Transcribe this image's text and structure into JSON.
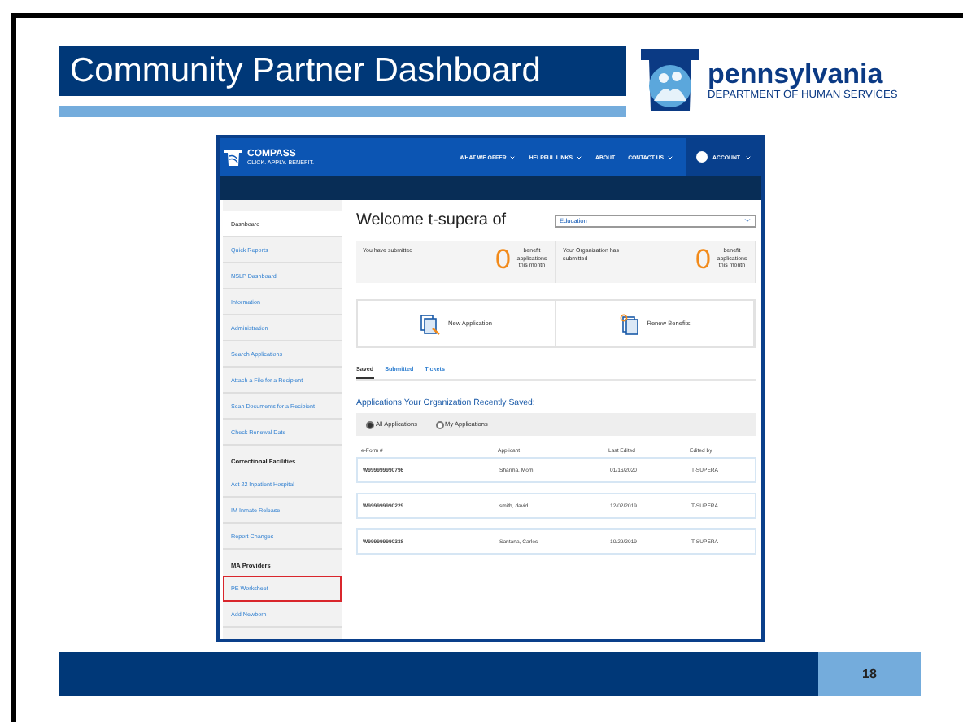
{
  "slide": {
    "title": "Community Partner Dashboard",
    "logo": {
      "name": "pennsylvania",
      "subtitle": "DEPARTMENT OF HUMAN SERVICES"
    },
    "page_number": "18"
  },
  "app": {
    "brand": {
      "name": "COMPASS",
      "tagline": "CLICK. APPLY. BENEFIT."
    },
    "nav": [
      {
        "label": "WHAT WE OFFER",
        "dropdown": true
      },
      {
        "label": "HELPFUL LINKS",
        "dropdown": true
      },
      {
        "label": "ABOUT",
        "dropdown": false
      },
      {
        "label": "CONTACT US",
        "dropdown": true
      }
    ],
    "account": {
      "label": "ACCOUNT"
    },
    "sidebar": [
      {
        "kind": "link",
        "label": "Dashboard",
        "selected": true,
        "highlighted": false
      },
      {
        "kind": "link",
        "label": "Quick Reports",
        "selected": false,
        "highlighted": false
      },
      {
        "kind": "link",
        "label": "NSLP Dashboard",
        "selected": false,
        "highlighted": false
      },
      {
        "kind": "link",
        "label": "Information",
        "selected": false,
        "highlighted": false
      },
      {
        "kind": "link",
        "label": "Administration",
        "selected": false,
        "highlighted": false
      },
      {
        "kind": "link",
        "label": "Search Applications",
        "selected": false,
        "highlighted": false
      },
      {
        "kind": "link",
        "label": "Attach a File for a Recipient",
        "selected": false,
        "highlighted": false
      },
      {
        "kind": "link",
        "label": "Scan Documents for a Recipient",
        "selected": false,
        "highlighted": false
      },
      {
        "kind": "link",
        "label": "Check Renewal Date",
        "selected": false,
        "highlighted": false
      },
      {
        "kind": "heading",
        "label": "Correctional Facilities"
      },
      {
        "kind": "link",
        "label": "Act 22 Inpatient Hospital",
        "selected": false,
        "highlighted": false
      },
      {
        "kind": "link",
        "label": "IM Inmate Release",
        "selected": false,
        "highlighted": false
      },
      {
        "kind": "link",
        "label": "Report Changes",
        "selected": false,
        "highlighted": false
      },
      {
        "kind": "heading",
        "label": "MA Providers"
      },
      {
        "kind": "link",
        "label": "PE Worksheet",
        "selected": false,
        "highlighted": true
      },
      {
        "kind": "link",
        "label": "Add Newborn",
        "selected": false,
        "highlighted": false
      }
    ],
    "welcome": "Welcome t-supera of",
    "organization_select": {
      "value": "Education"
    },
    "stats": [
      {
        "label": "You have submitted",
        "count": "0",
        "unit": "benefit applications this month"
      },
      {
        "label": "Your Organization has submitted",
        "count": "0",
        "unit": "benefit applications this month"
      }
    ],
    "actions": [
      {
        "kind": "new",
        "label": "New Application"
      },
      {
        "kind": "renew",
        "label": "Renew Benefits"
      }
    ],
    "tabs": [
      {
        "label": "Saved",
        "selected": true
      },
      {
        "label": "Submitted",
        "selected": false
      },
      {
        "label": "Tickets",
        "selected": false
      }
    ],
    "section_title": "Applications Your Organization Recently Saved:",
    "filters": [
      {
        "label": "All Applications",
        "selected": true
      },
      {
        "label": "My Applications",
        "selected": false
      }
    ],
    "table": {
      "columns": [
        "e-Form #",
        "Applicant",
        "Last Edited",
        "Edited by"
      ],
      "rows": [
        [
          "W999999990796",
          "Sharma, Mom",
          "01/16/2020",
          "T-SUPERA"
        ],
        [
          "W999999990229",
          "smith, david",
          "12/02/2019",
          "T-SUPERA"
        ],
        [
          "W999999990338",
          "Santana, Carlos",
          "10/29/2019",
          "T-SUPERA"
        ]
      ]
    }
  }
}
